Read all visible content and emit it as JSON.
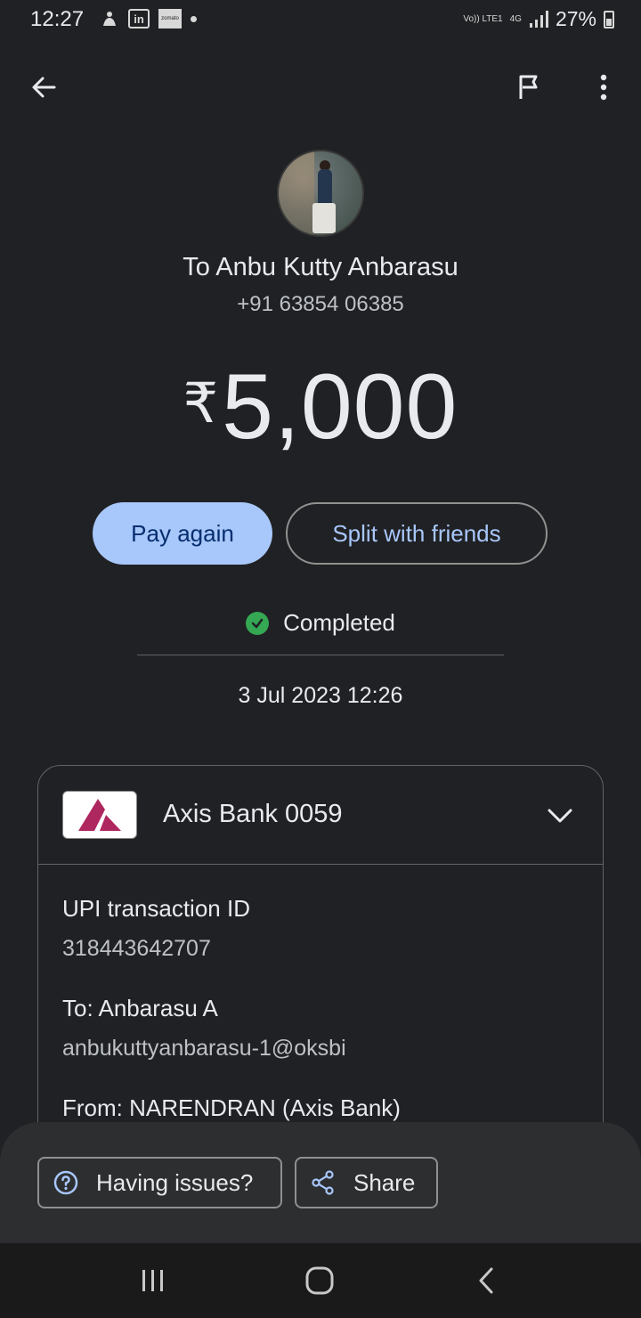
{
  "status_bar": {
    "time": "12:27",
    "battery": "27%",
    "network_label": "Vo)) LTE1",
    "network_type": "4G"
  },
  "toolbar": {
    "back_icon": "arrow-back-icon",
    "flag_icon": "flag-icon",
    "menu_icon": "more-vert-icon"
  },
  "recipient": {
    "name": "To Anbu Kutty Anbarasu",
    "phone": "+91 63854 06385"
  },
  "amount": {
    "currency": "₹",
    "value": "5,000"
  },
  "actions": {
    "pay_again": "Pay again",
    "split": "Split with friends"
  },
  "transaction": {
    "status": "Completed",
    "date": "3 Jul 2023 12:26"
  },
  "account": {
    "bank_name": "Axis Bank 0059",
    "upi_label": "UPI transaction ID",
    "upi_id": "318443642707",
    "to_label": "To: Anbarasu  A",
    "to_upi": "anbukuttyanbarasu-1@oksbi",
    "from_label": "From: NARENDRAN   (Axis Bank)"
  },
  "sheet": {
    "issues": "Having issues?",
    "share": "Share"
  },
  "colors": {
    "background": "#202124",
    "accent": "#a8c7fa",
    "success": "#34a853",
    "axis_brand": "#ae275f"
  }
}
